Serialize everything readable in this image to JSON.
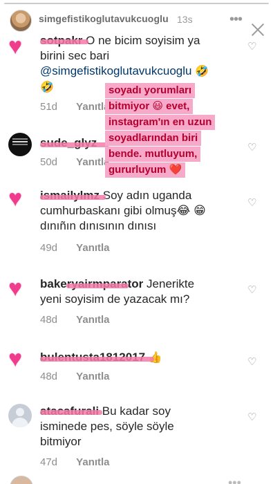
{
  "story": {
    "username": "simgefistikoglutavukcuoglu",
    "time": "13s",
    "menu_icon": "more-dots-icon",
    "close_icon": "close-icon"
  },
  "caption": {
    "lines": [
      "soyadı yorumları",
      "bitmiyor 😃 evet,",
      "instagram'ın en uzun",
      "soyadlarından biri",
      "bende. mutluyum,",
      "gururluyum ❤️"
    ]
  },
  "comments": [
    {
      "username": "sotpakr",
      "line1": "O ne bicim  soyisim ya",
      "line2": "birini sec bari",
      "mention": "@simgefistikoglutavukcuoglu",
      "emoji1": "🤣",
      "emoji2": "🤣",
      "ago": "51d",
      "reply": "Yanıtla"
    },
    {
      "username": "sude_glyz",
      "line1": "",
      "ago": "50d",
      "reply": "Yanıtla"
    },
    {
      "username": "ismailylmz",
      "line1": "Soy adın uganda",
      "line2": "cumhurbaskanı gibi olmuş😂 😁",
      "line3": "dınıñın dınısının dınısı",
      "ago": "49d",
      "reply": "Yanıtla"
    },
    {
      "username": "bakeryairmparator",
      "line1": "Jenerikte",
      "line2": "yeni soyisim de yazacak mı?",
      "ago": "48d",
      "reply": "Yanıtla"
    },
    {
      "username": "bulentusta1812017",
      "line1": "👍",
      "ago": "48d",
      "reply": "Yanıtla"
    },
    {
      "username": "atacafurali",
      "line1": "Bu kadar soy",
      "line2": "isminede pes, söyle söyle",
      "line3": "bitmiyor",
      "ago": "47d",
      "reply": "Yanıtla"
    }
  ]
}
